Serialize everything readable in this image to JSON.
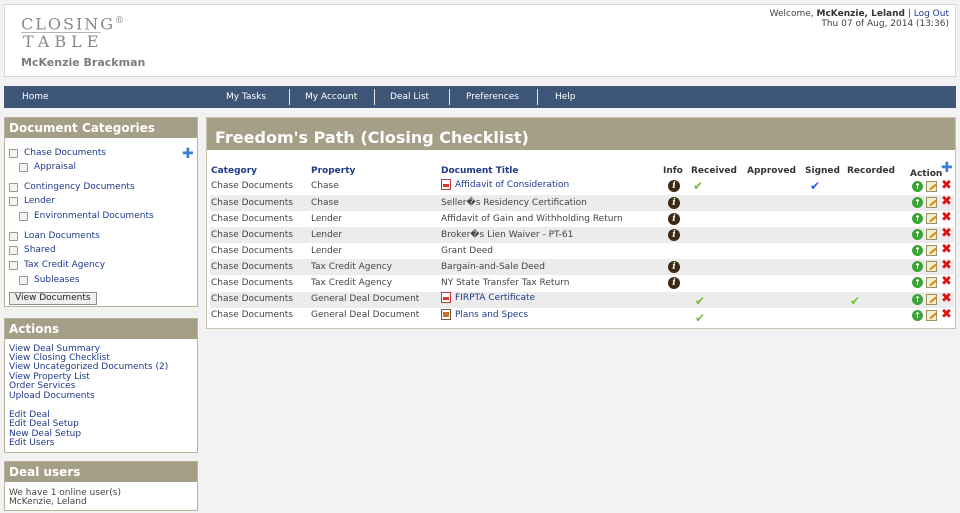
{
  "header": {
    "logo_line1": "CLOSING",
    "logo_reg": "®",
    "logo_line2": "TABLE",
    "company": "McKenzie Brackman",
    "welcome_prefix": "Welcome, ",
    "user_name": "McKenzie, Leland",
    "logout_sep": " | ",
    "logout": "Log Out",
    "datetime": "Thu 07 of Aug, 2014 (13:36)"
  },
  "nav": {
    "home": "Home",
    "my_tasks": "My Tasks",
    "my_account": "My Account",
    "deal_list": "Deal List",
    "preferences": "Preferences",
    "help": "Help"
  },
  "categories": {
    "title": "Document Categories",
    "items": [
      {
        "label": "Chase Documents"
      },
      {
        "label": "Appraisal"
      },
      {
        "label": "Contingency Documents"
      },
      {
        "label": "Lender"
      },
      {
        "label": "Environmental Documents"
      },
      {
        "label": "Loan Documents"
      },
      {
        "label": "Shared"
      },
      {
        "label": "Tax Credit Agency"
      },
      {
        "label": "Subleases"
      }
    ],
    "button": "View Documents",
    "add_icon": "plus-icon"
  },
  "actions": {
    "title": "Actions",
    "group1": [
      "View Deal Summary",
      "View Closing Checklist",
      "View Uncategorized Documents (2)",
      "View Property List",
      "Order Services",
      "Upload Documents"
    ],
    "group2": [
      "Edit Deal",
      "Edit Deal Setup",
      "New Deal Setup",
      "Edit Users"
    ]
  },
  "deal_users": {
    "title": "Deal users",
    "line1": "We have 1 online user(s)",
    "line2": "McKenzie, Leland"
  },
  "checklist": {
    "title": "Freedom's Path (Closing Checklist)",
    "columns": {
      "category": "Category",
      "property": "Property",
      "document_title": "Document Title",
      "info": "Info",
      "received": "Received",
      "approved": "Approved",
      "signed": "Signed",
      "recorded": "Recorded",
      "action": "Action"
    },
    "rows": [
      {
        "category": "Chase Documents",
        "property": "Chase",
        "title": "Affidavit of Consideration",
        "file": "pdf",
        "info": true,
        "received": true,
        "approved": false,
        "signed": true,
        "recorded": false
      },
      {
        "category": "Chase Documents",
        "property": "Chase",
        "title": "Seller�s Residency Certification",
        "file": "",
        "info": true,
        "received": false,
        "approved": false,
        "signed": false,
        "recorded": false
      },
      {
        "category": "Chase Documents",
        "property": "Lender",
        "title": "Affidavit of Gain and Withholding Return",
        "file": "",
        "info": true,
        "received": false,
        "approved": false,
        "signed": false,
        "recorded": false
      },
      {
        "category": "Chase Documents",
        "property": "Lender",
        "title": "Broker�s Lien Waiver - PT-61",
        "file": "",
        "info": true,
        "received": false,
        "approved": false,
        "signed": false,
        "recorded": false
      },
      {
        "category": "Chase Documents",
        "property": "Lender",
        "title": "Grant Deed",
        "file": "",
        "info": false,
        "received": false,
        "approved": false,
        "signed": false,
        "recorded": false
      },
      {
        "category": "Chase Documents",
        "property": "Tax Credit Agency",
        "title": "Bargain-and-Sale Deed",
        "file": "",
        "info": true,
        "received": false,
        "approved": false,
        "signed": false,
        "recorded": false
      },
      {
        "category": "Chase Documents",
        "property": "Tax Credit Agency",
        "title": "NY State Transfer Tax Return",
        "file": "",
        "info": true,
        "received": false,
        "approved": false,
        "signed": false,
        "recorded": false
      },
      {
        "category": "Chase Documents",
        "property": "General Deal Document",
        "title": "FIRPTA Certificate",
        "file": "pdf",
        "info": false,
        "received": true,
        "approved": false,
        "signed": false,
        "recorded": true
      },
      {
        "category": "Chase Documents",
        "property": "General Deal Document",
        "title": "Plans and Specs",
        "file": "doc",
        "info": false,
        "received": true,
        "approved": false,
        "signed": false,
        "recorded": false
      }
    ]
  },
  "colors": {
    "nav_bg": "#3d5678",
    "panel_title_bg": "#a59f88",
    "link": "#1f3a8a",
    "check_green": "#6fbf3a",
    "check_blue": "#2d5fd6"
  }
}
